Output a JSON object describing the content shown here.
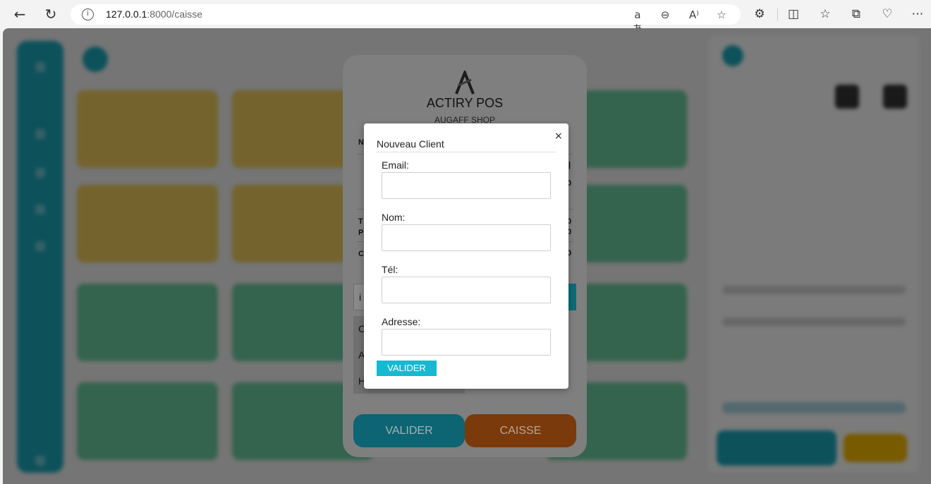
{
  "browser": {
    "url_host": "127.0.0.1",
    "url_path": ":8000/caisse"
  },
  "receipt": {
    "brand": "ACTIRY POS",
    "shop": "AUGAFF SHOP",
    "partial_labels": [
      "N",
      "T",
      "P",
      "C"
    ],
    "partial_values": [
      "0",
      "0",
      "0",
      "0"
    ],
    "input_partial": "i",
    "list_partial": [
      "C",
      "A",
      "H"
    ],
    "valider_label": "VALIDER",
    "caisse_label": "CAISSE",
    "accent_teal": "#0d6472",
    "accent_brown": "#7a3a0b"
  },
  "client_modal": {
    "title": "Nouveau Client",
    "close_label": "×",
    "fields": [
      {
        "label": "Email:",
        "value": ""
      },
      {
        "label": "Nom:",
        "value": ""
      },
      {
        "label": "Tél:",
        "value": ""
      },
      {
        "label": "Adresse:",
        "value": ""
      }
    ],
    "submit_label": "VALIDER",
    "submit_color": "#17b8d1"
  },
  "icons": [
    "back-icon",
    "reload-icon",
    "info-icon",
    "translate-icon",
    "zoom-out-icon",
    "read-aloud-icon",
    "favorite-star-icon",
    "extensions-icon",
    "split-screen-icon",
    "favorites-icon",
    "collections-icon",
    "browser-essentials-icon",
    "more-icon"
  ]
}
